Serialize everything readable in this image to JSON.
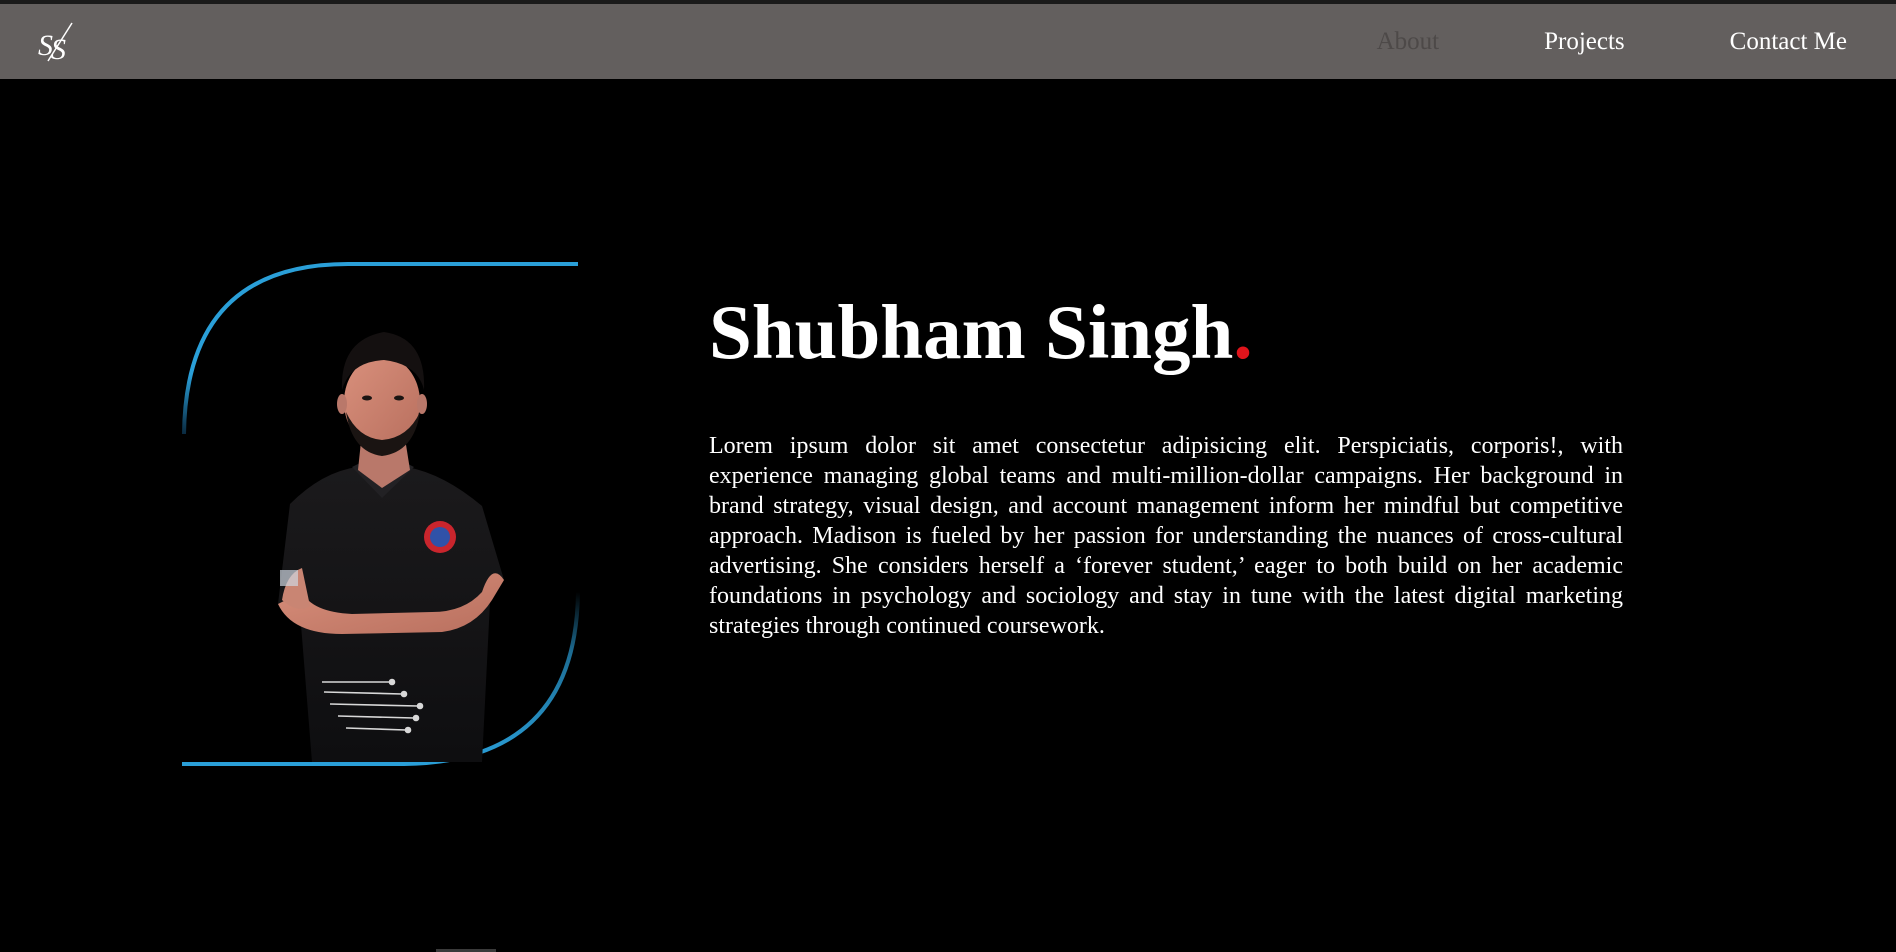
{
  "nav": {
    "logo_text": "SS",
    "links": [
      {
        "label": "About",
        "state": "active",
        "color": "#4d4948"
      },
      {
        "label": "Projects",
        "state": "default",
        "color": "#ffffff"
      },
      {
        "label": "Contact Me",
        "state": "default",
        "color": "#ffffff"
      }
    ]
  },
  "hero": {
    "name": "Shubham Singh",
    "name_dot": ".",
    "bio": "Lorem ipsum dolor sit amet consectetur adipisicing elit. Perspiciatis, corporis!, with experience managing global teams and multi-million-dollar campaigns. Her background in brand strategy, visual design, and account management inform her mindful but competitive approach. Madison is fueled by her passion for understanding the nuances of cross-cultural advertising. She considers herself a ‘forever student,’ eager to both build on her academic foundations in psychology and sociology and stay in tune with the latest digital marketing strategies through continued coursework."
  },
  "colors": {
    "navbar_bg": "#635f5e",
    "page_bg": "#000000",
    "accent_blue": "#2a9fd8",
    "accent_red": "#e0141b",
    "text": "#ffffff"
  },
  "icons": {
    "logo": "ss-monogram-logo",
    "portrait": "profile-photo"
  }
}
